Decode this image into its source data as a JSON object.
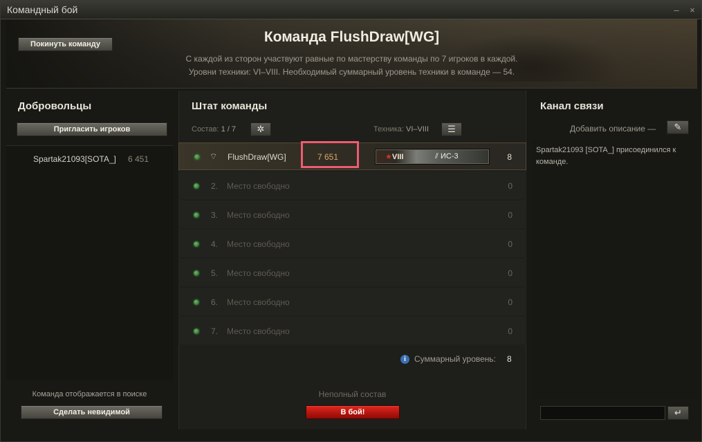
{
  "window": {
    "title": "Командный бой",
    "min_glyph": "–",
    "close_glyph": "×"
  },
  "header": {
    "leave_button": "Покинуть команду",
    "team_title": "Команда FlushDraw[WG]",
    "description_1": "С каждой из сторон участвуют равные по мастерству команды по 7 игроков в каждой.",
    "description_2": "Уровни техники: VI–VIII. Необходимый суммарный уровень техники в команде — 54."
  },
  "volunteers": {
    "title": "Добровольцы",
    "invite_button": "Пригласить игроков",
    "players": [
      {
        "name": "Spartak21093[SOTA_]",
        "rating": "6 451"
      }
    ],
    "search_status": "Команда отображается в поиске",
    "invisible_button": "Сделать невидимой"
  },
  "roster": {
    "title": "Штат команды",
    "composition_label": "Состав:",
    "composition_value": "1 / 7",
    "tech_label": "Техника:",
    "tech_value": "VI–VIII",
    "settings_icon": "gear-icon",
    "filter_icon": "sliders-icon",
    "slots": [
      {
        "number": "",
        "name": "FlushDraw[WG]",
        "rating": "7 651",
        "tank_tier": "VIII",
        "tank_name": "ИС-3",
        "level": "8"
      },
      {
        "number": "2.",
        "name": "Место свободно",
        "level": "0"
      },
      {
        "number": "3.",
        "name": "Место свободно",
        "level": "0"
      },
      {
        "number": "4.",
        "name": "Место свободно",
        "level": "0"
      },
      {
        "number": "5.",
        "name": "Место свободно",
        "level": "0"
      },
      {
        "number": "6.",
        "name": "Место свободно",
        "level": "0"
      },
      {
        "number": "7.",
        "name": "Место свободно",
        "level": "0"
      }
    ],
    "summary_label": "Суммарный уровень:",
    "summary_value": "8",
    "status": "Неполный состав",
    "battle_button": "В бой!"
  },
  "chat": {
    "title": "Канал связи",
    "add_description": "Добавить описание —",
    "message": "Spartak21093 [SOTA_] присоединился к команде.",
    "input_value": "",
    "send_glyph": "↵"
  },
  "colors": {
    "accent_red": "#c8150d",
    "highlight_box": "#ef5b72",
    "online_dot": "#4fa34c"
  }
}
